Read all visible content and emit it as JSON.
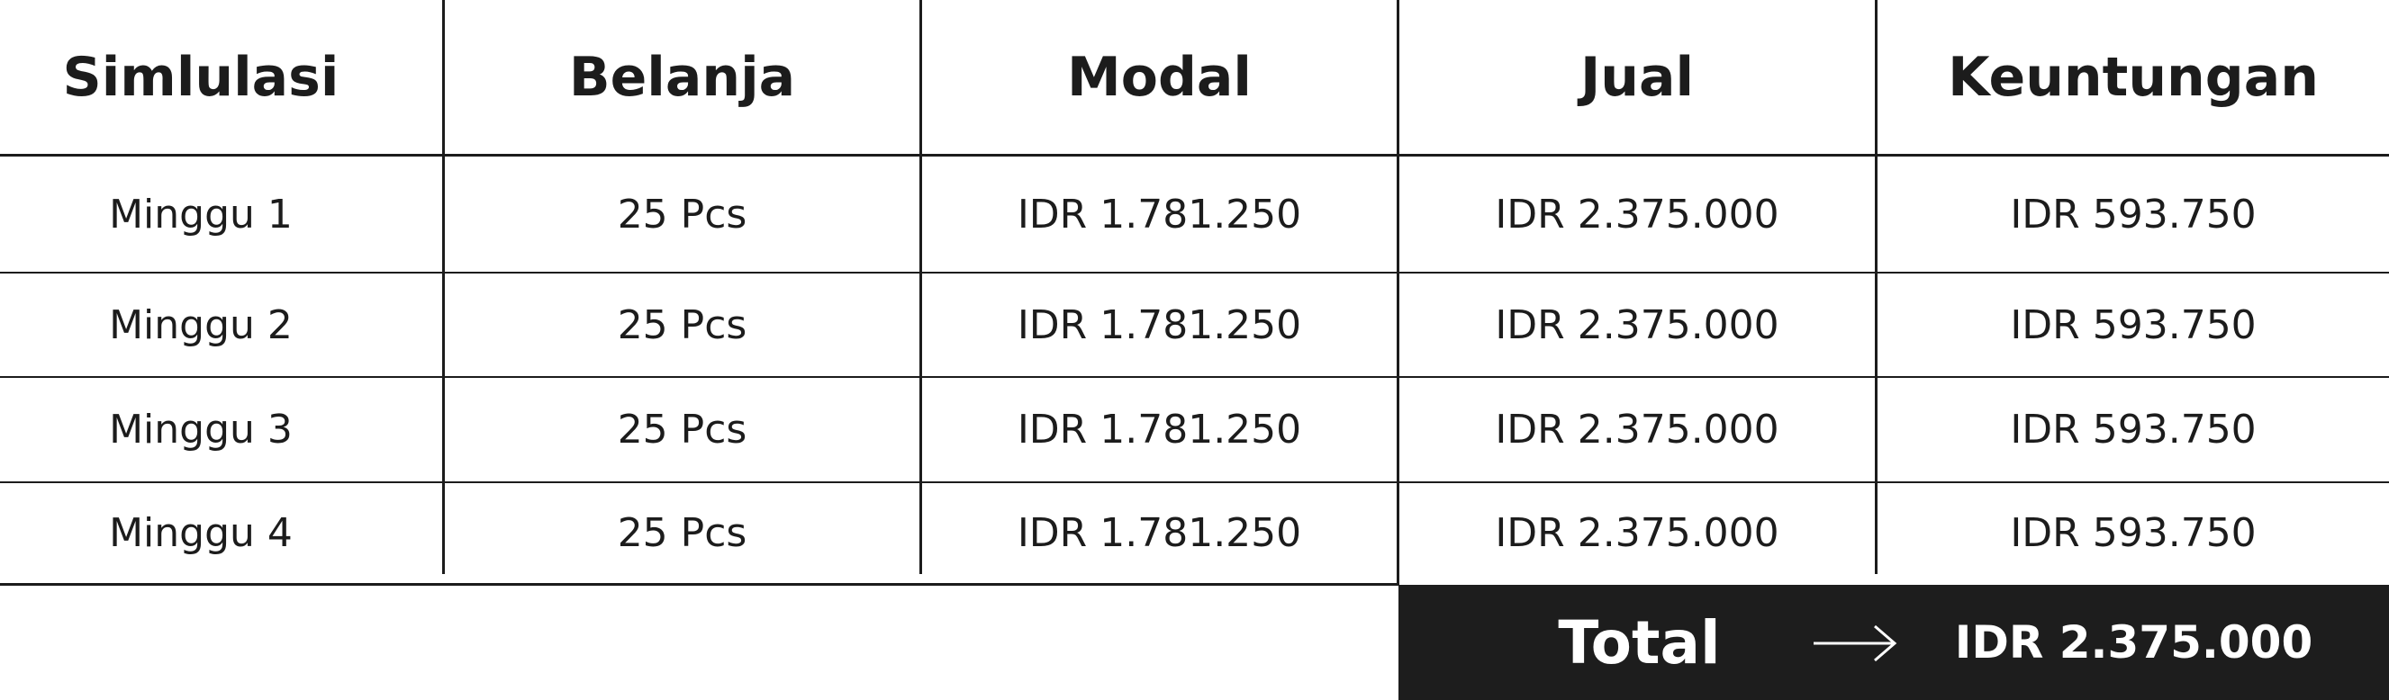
{
  "table": {
    "headers": [
      "Simlulasi",
      "Belanja",
      "Modal",
      "Jual",
      "Keuntungan"
    ],
    "rows": [
      [
        "Minggu 1",
        "25 Pcs",
        "IDR 1.781.250",
        "IDR 2.375.000",
        "IDR 593.750"
      ],
      [
        "Minggu 2",
        "25 Pcs",
        "IDR 1.781.250",
        "IDR 2.375.000",
        "IDR 593.750"
      ],
      [
        "Minggu 3",
        "25 Pcs",
        "IDR 1.781.250",
        "IDR 2.375.000",
        "IDR 593.750"
      ],
      [
        "Minggu 4",
        "25 Pcs",
        "IDR 1.781.250",
        "IDR 2.375.000",
        "IDR 593.750"
      ]
    ]
  },
  "total": {
    "label": "Total",
    "arrow_icon": "arrow-right-icon",
    "value": "IDR 2.375.000"
  },
  "colors": {
    "ink": "#1c1c1c",
    "total_bar": "#1d1d1d",
    "background": "#ffffff"
  }
}
